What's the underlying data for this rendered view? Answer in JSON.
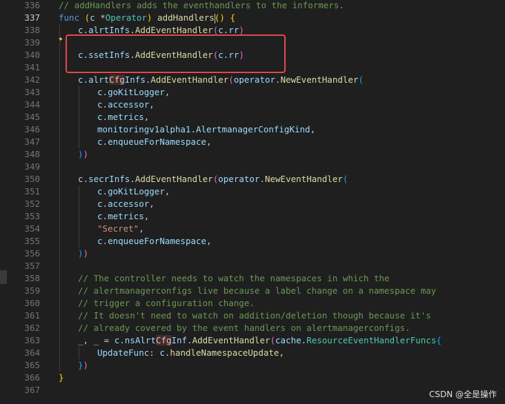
{
  "lines": [
    {
      "n": "336",
      "tokens": [
        {
          "c": "cm",
          "t": "// addHandlers adds the eventhandlers to the informers."
        }
      ]
    },
    {
      "n": "337",
      "active": true,
      "tokens": [
        {
          "c": "kw",
          "t": "func"
        },
        {
          "t": " "
        },
        {
          "c": "p1",
          "t": "("
        },
        {
          "c": "vr",
          "t": "c"
        },
        {
          "t": " *"
        },
        {
          "c": "ty",
          "t": "Operator"
        },
        {
          "c": "p1",
          "t": ")"
        },
        {
          "t": " "
        },
        {
          "c": "fn",
          "t": "addHandlers"
        },
        {
          "c": "p1",
          "t": "()"
        },
        {
          "t": " "
        },
        {
          "c": "p1",
          "t": "{"
        }
      ]
    },
    {
      "n": "338",
      "tokens": [
        {
          "c": "vr",
          "t": "c"
        },
        {
          "t": "."
        },
        {
          "c": "vr",
          "t": "alrtInfs"
        },
        {
          "t": "."
        },
        {
          "c": "fn",
          "t": "AddEventHandler"
        },
        {
          "c": "p2",
          "t": "("
        },
        {
          "c": "vr",
          "t": "c"
        },
        {
          "t": "."
        },
        {
          "c": "vr",
          "t": "rr"
        },
        {
          "c": "p2",
          "t": ")"
        }
      ]
    },
    {
      "n": "339",
      "tokens": []
    },
    {
      "n": "340",
      "tokens": [
        {
          "c": "vr",
          "t": "c"
        },
        {
          "t": "."
        },
        {
          "c": "vr",
          "t": "ssetInfs"
        },
        {
          "t": "."
        },
        {
          "c": "fn",
          "t": "AddEventHandler"
        },
        {
          "c": "p2",
          "t": "("
        },
        {
          "c": "vr",
          "t": "c"
        },
        {
          "t": "."
        },
        {
          "c": "vr",
          "t": "rr"
        },
        {
          "c": "p2",
          "t": ")"
        }
      ]
    },
    {
      "n": "341",
      "tokens": []
    },
    {
      "n": "342",
      "tokens": [
        {
          "c": "vr",
          "t": "c"
        },
        {
          "t": "."
        },
        {
          "c": "vr",
          "t": "alrt"
        },
        {
          "c": "hl",
          "t": "Cfg"
        },
        {
          "c": "vr",
          "t": "Infs"
        },
        {
          "t": "."
        },
        {
          "c": "fn",
          "t": "AddEventHandler"
        },
        {
          "c": "p2",
          "t": "("
        },
        {
          "c": "vr",
          "t": "operator"
        },
        {
          "t": "."
        },
        {
          "c": "fn",
          "t": "NewEventHandler"
        },
        {
          "c": "p3",
          "t": "("
        }
      ]
    },
    {
      "n": "343",
      "tokens": [
        {
          "c": "vr",
          "t": "c"
        },
        {
          "t": "."
        },
        {
          "c": "vr",
          "t": "goKitLogger"
        },
        {
          "t": ","
        }
      ]
    },
    {
      "n": "344",
      "tokens": [
        {
          "c": "vr",
          "t": "c"
        },
        {
          "t": "."
        },
        {
          "c": "vr",
          "t": "accessor"
        },
        {
          "t": ","
        }
      ]
    },
    {
      "n": "345",
      "tokens": [
        {
          "c": "vr",
          "t": "c"
        },
        {
          "t": "."
        },
        {
          "c": "vr",
          "t": "metrics"
        },
        {
          "t": ","
        }
      ]
    },
    {
      "n": "346",
      "tokens": [
        {
          "c": "vr",
          "t": "monitoringv1alpha1"
        },
        {
          "t": "."
        },
        {
          "c": "vr",
          "t": "AlertmanagerConfigKind"
        },
        {
          "t": ","
        }
      ]
    },
    {
      "n": "347",
      "tokens": [
        {
          "c": "vr",
          "t": "c"
        },
        {
          "t": "."
        },
        {
          "c": "vr",
          "t": "enqueueForNamespace"
        },
        {
          "t": ","
        }
      ]
    },
    {
      "n": "348",
      "tokens": [
        {
          "c": "p3",
          "t": ")"
        },
        {
          "c": "p2",
          "t": ")"
        }
      ]
    },
    {
      "n": "349",
      "tokens": []
    },
    {
      "n": "350",
      "tokens": [
        {
          "c": "vr",
          "t": "c"
        },
        {
          "t": "."
        },
        {
          "c": "vr",
          "t": "secrInfs"
        },
        {
          "t": "."
        },
        {
          "c": "fn",
          "t": "AddEventHandler"
        },
        {
          "c": "p2",
          "t": "("
        },
        {
          "c": "vr",
          "t": "operator"
        },
        {
          "t": "."
        },
        {
          "c": "fn",
          "t": "NewEventHandler"
        },
        {
          "c": "p3",
          "t": "("
        }
      ]
    },
    {
      "n": "351",
      "tokens": [
        {
          "c": "vr",
          "t": "c"
        },
        {
          "t": "."
        },
        {
          "c": "vr",
          "t": "goKitLogger"
        },
        {
          "t": ","
        }
      ]
    },
    {
      "n": "352",
      "tokens": [
        {
          "c": "vr",
          "t": "c"
        },
        {
          "t": "."
        },
        {
          "c": "vr",
          "t": "accessor"
        },
        {
          "t": ","
        }
      ]
    },
    {
      "n": "353",
      "tokens": [
        {
          "c": "vr",
          "t": "c"
        },
        {
          "t": "."
        },
        {
          "c": "vr",
          "t": "metrics"
        },
        {
          "t": ","
        }
      ]
    },
    {
      "n": "354",
      "tokens": [
        {
          "c": "st",
          "t": "\"Secret\""
        },
        {
          "t": ","
        }
      ]
    },
    {
      "n": "355",
      "tokens": [
        {
          "c": "vr",
          "t": "c"
        },
        {
          "t": "."
        },
        {
          "c": "vr",
          "t": "enqueueForNamespace"
        },
        {
          "t": ","
        }
      ]
    },
    {
      "n": "356",
      "tokens": [
        {
          "c": "p3",
          "t": ")"
        },
        {
          "c": "p2",
          "t": ")"
        }
      ]
    },
    {
      "n": "357",
      "tokens": []
    },
    {
      "n": "358",
      "tokens": [
        {
          "c": "cm",
          "t": "// The controller needs to watch the namespaces in which the"
        }
      ]
    },
    {
      "n": "359",
      "tokens": [
        {
          "c": "cm",
          "t": "// alertmanagerconfigs live because a label change on a namespace may"
        }
      ]
    },
    {
      "n": "360",
      "tokens": [
        {
          "c": "cm",
          "t": "// trigger a configuration change."
        }
      ]
    },
    {
      "n": "361",
      "tokens": [
        {
          "c": "cm",
          "t": "// It doesn't need to watch on addition/deletion though because it's"
        }
      ]
    },
    {
      "n": "362",
      "tokens": [
        {
          "c": "cm",
          "t": "// already covered by the event handlers on alertmanagerconfigs."
        }
      ]
    },
    {
      "n": "363",
      "tokens": [
        {
          "c": "vr",
          "t": "_"
        },
        {
          "t": ", "
        },
        {
          "c": "vr",
          "t": "_"
        },
        {
          "t": " = "
        },
        {
          "c": "vr",
          "t": "c"
        },
        {
          "t": "."
        },
        {
          "c": "vr",
          "t": "nsAlrt"
        },
        {
          "c": "hl",
          "t": "Cfg"
        },
        {
          "c": "vr",
          "t": "Inf"
        },
        {
          "t": "."
        },
        {
          "c": "fn",
          "t": "AddEventHandler"
        },
        {
          "c": "p2",
          "t": "("
        },
        {
          "c": "vr",
          "t": "cache"
        },
        {
          "t": "."
        },
        {
          "c": "ty",
          "t": "ResourceEventHandlerFuncs"
        },
        {
          "c": "p3",
          "t": "{"
        }
      ]
    },
    {
      "n": "364",
      "tokens": [
        {
          "c": "vr",
          "t": "UpdateFunc"
        },
        {
          "t": ": "
        },
        {
          "c": "vr",
          "t": "c"
        },
        {
          "t": "."
        },
        {
          "c": "fn",
          "t": "handleNamespaceUpdate"
        },
        {
          "t": ","
        }
      ]
    },
    {
      "n": "365",
      "tokens": [
        {
          "c": "p3",
          "t": "}"
        },
        {
          "c": "p2",
          "t": ")"
        }
      ]
    },
    {
      "n": "366",
      "tokens": [
        {
          "c": "p1",
          "t": "}"
        }
      ]
    },
    {
      "n": "367",
      "tokens": []
    }
  ],
  "sparkle_icon": "✦",
  "watermark": "CSDN @全是操作",
  "colors": {
    "background": "#1f1f1f",
    "highlight_box": "#e5484d"
  }
}
